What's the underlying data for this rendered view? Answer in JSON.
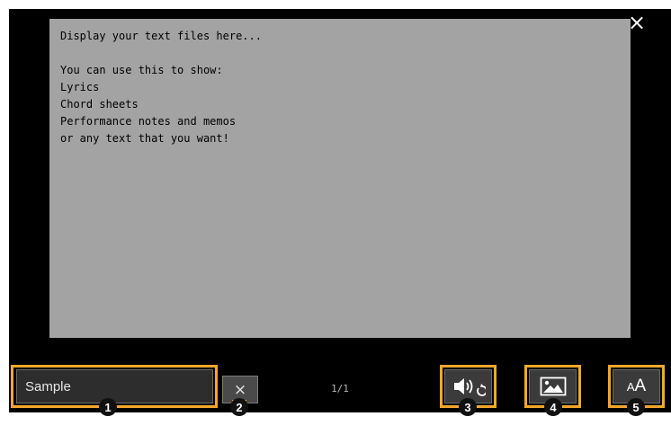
{
  "text_view": {
    "lines": [
      "Display your text files here...",
      "",
      "You can use this to show:",
      "Lyrics",
      "Chord sheets",
      "Performance notes and memos",
      "or any text that you want!"
    ]
  },
  "toolbar": {
    "file_name": "Sample",
    "clear_label": "×",
    "page_indicator": "1/1",
    "font_size_label": "AA"
  },
  "window": {
    "close_label": "×"
  },
  "callouts": [
    "1",
    "2",
    "3",
    "4",
    "5"
  ],
  "colors": {
    "highlight": "#f4a72c",
    "screen": "#000000",
    "text_bg": "#a3a3a3"
  },
  "icons": [
    "close-icon",
    "clear-icon",
    "speaker-repeat-icon",
    "image-icon",
    "font-size-icon"
  ]
}
